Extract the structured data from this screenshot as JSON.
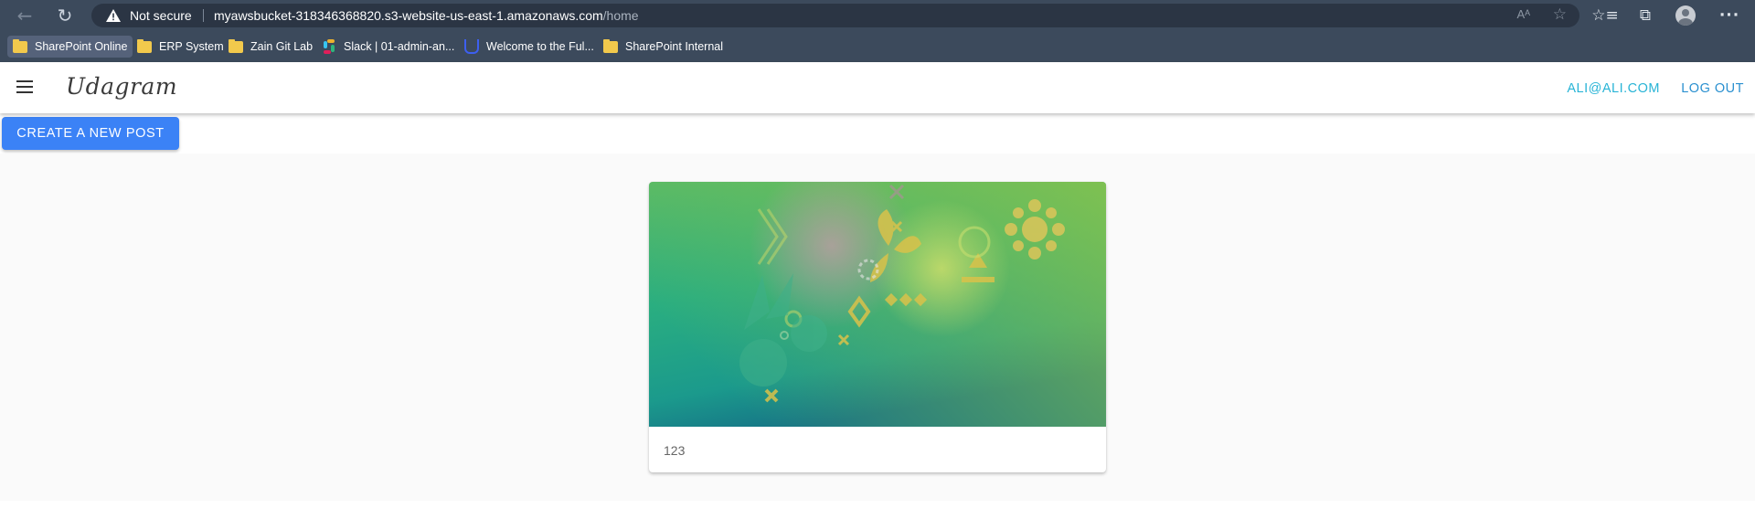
{
  "browser": {
    "security_label": "Not secure",
    "url_host": "myawsbucket-318346368820.s3-website-us-east-1.amazonaws.com",
    "url_path": "/home",
    "read_aloud_glyph": "Aᴬ"
  },
  "bookmarks": [
    {
      "label": "SharePoint Online",
      "icon": "folder-icon"
    },
    {
      "label": "ERP System",
      "icon": "folder-icon"
    },
    {
      "label": "Zain Git Lab",
      "icon": "folder-icon"
    },
    {
      "label": "Slack | 01-admin-an...",
      "icon": "slack-icon"
    },
    {
      "label": "Welcome to the Ful...",
      "icon": "udacity-icon"
    },
    {
      "label": "SharePoint Internal",
      "icon": "folder-icon"
    }
  ],
  "app": {
    "brand": "Udagram",
    "user_email": "ALI@ALI.COM",
    "logout_label": "LOG OUT",
    "create_post_label": "CREATE A NEW POST"
  },
  "feed": {
    "items": [
      {
        "caption": "123",
        "image": "abstract-green-teal-pattern"
      }
    ]
  },
  "colors": {
    "chrome": "#3c4a5c",
    "accent": "#3b82f6",
    "email": "#28b4d6",
    "logout": "#2a90d0"
  }
}
